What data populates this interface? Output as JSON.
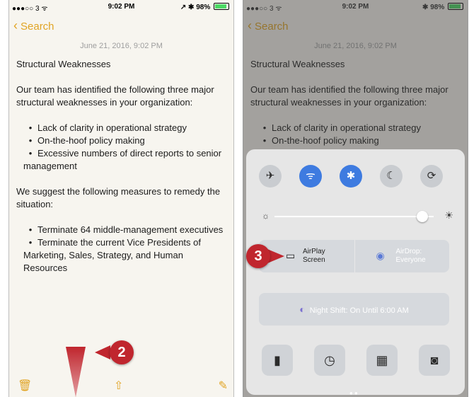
{
  "left_phone": {
    "status": {
      "carrier": "●●●○○ 3 ᯤ",
      "time": "9:02 PM",
      "right": "↗ ✱ 98%"
    },
    "back_label": "Search",
    "date": "June 21, 2016, 9:02 PM",
    "note": {
      "title": "Structural Weaknesses",
      "intro": "Our team has identified the following three major structural weaknesses in your organization:",
      "weaknesses": [
        "Lack of clarity in operational strategy",
        "On-the-hoof policy making",
        "Excessive numbers of direct reports to senior management"
      ],
      "suggestion": "We suggest the following measures to remedy the situation:",
      "measures": [
        "Terminate 64 middle-management executives",
        "Terminate the current Vice Presidents of Marketing, Sales, Strategy, and Human Resources"
      ]
    },
    "toolbar": {
      "trash_icon": "trash-icon",
      "share_icon": "share-icon",
      "compose_icon": "compose-icon"
    },
    "callout": {
      "number": "2",
      "color": "#c0262e"
    }
  },
  "right_phone": {
    "status": {
      "carrier": "●●●○○ 3 ᯤ",
      "time": "9:02 PM",
      "right": "✱ 98%"
    },
    "back_label": "Search",
    "date": "June 21, 2016, 9:02 PM",
    "note": {
      "title": "Structural Weaknesses",
      "intro": "Our team has identified the following three major structural weaknesses in your organization:",
      "weaknesses": [
        "Lack of clarity in operational strategy",
        "On-the-hoof policy making"
      ]
    },
    "control_center": {
      "toggles": [
        {
          "name": "airplane-mode",
          "glyph": "✈",
          "on": false
        },
        {
          "name": "wifi",
          "glyph": "ᯤ",
          "on": true
        },
        {
          "name": "bluetooth",
          "glyph": "✱",
          "on": true
        },
        {
          "name": "do-not-disturb",
          "glyph": "☾",
          "on": false
        },
        {
          "name": "rotation-lock",
          "glyph": "⟳",
          "on": false
        }
      ],
      "brightness_level": 0.93,
      "airplay": {
        "line1": "AirPlay",
        "line2": "Screen"
      },
      "airdrop": {
        "line1": "AirDrop:",
        "line2": "Everyone"
      },
      "night_shift": "Night Shift: On Until 6:00 AM",
      "tools": [
        {
          "name": "flashlight",
          "glyph": "▮"
        },
        {
          "name": "timer",
          "glyph": "◷"
        },
        {
          "name": "calculator",
          "glyph": "▦"
        },
        {
          "name": "camera",
          "glyph": "◙"
        }
      ],
      "accent_color": "#3e7be0"
    },
    "callout": {
      "number": "3",
      "color": "#c0262e"
    }
  }
}
